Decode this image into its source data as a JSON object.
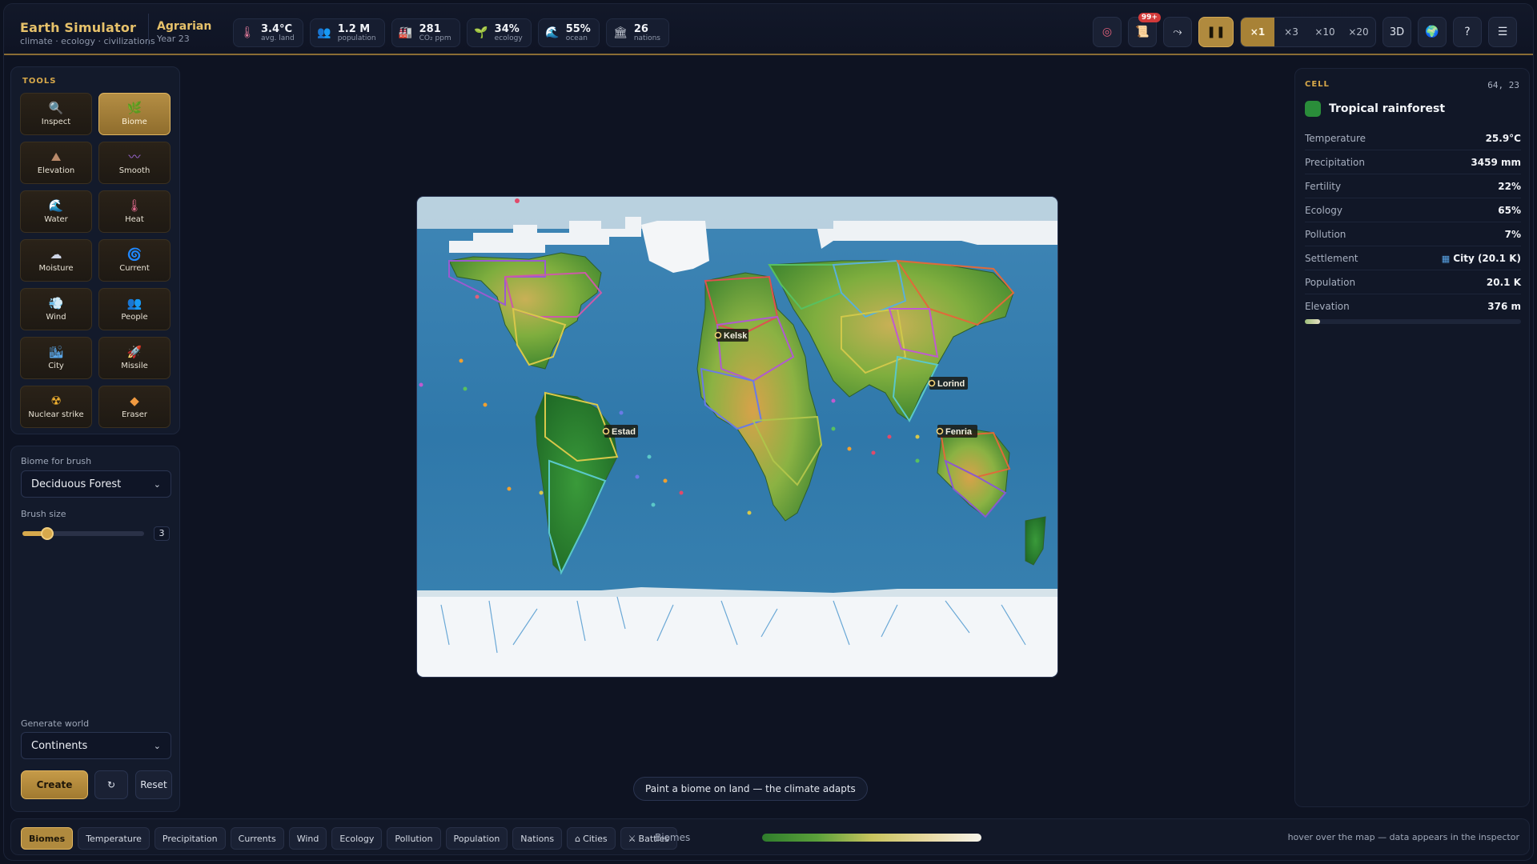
{
  "app": {
    "title": "Earth Simulator",
    "subtitle": "climate · ecology · civilizations",
    "era": "Agrarian",
    "year": "Year 23"
  },
  "stats": [
    {
      "icon": "thermometer-icon",
      "value": "3.4°C",
      "label": "avg. land"
    },
    {
      "icon": "people-icon",
      "value": "1.2 M",
      "label": "population"
    },
    {
      "icon": "factory-icon",
      "value": "281",
      "label": "CO₂ ppm"
    },
    {
      "icon": "sprout-icon",
      "value": "34%",
      "label": "ecology"
    },
    {
      "icon": "wave-icon",
      "value": "55%",
      "label": "ocean"
    },
    {
      "icon": "institution-icon",
      "value": "26",
      "label": "nations"
    }
  ],
  "controls": {
    "notifications_badge": "99+",
    "speeds": [
      "×1",
      "×3",
      "×10",
      "×20"
    ],
    "active_speed": "×1",
    "view_3d": "3D",
    "help": "?"
  },
  "tools": {
    "heading": "TOOLS",
    "items": [
      {
        "label": "Inspect",
        "icon": "magnifier-icon",
        "active": false
      },
      {
        "label": "Biome",
        "icon": "leaf-icon",
        "active": true
      },
      {
        "label": "Elevation",
        "icon": "mountain-icon",
        "active": false
      },
      {
        "label": "Smooth",
        "icon": "wave-icon",
        "active": false
      },
      {
        "label": "Water",
        "icon": "water-icon",
        "active": false
      },
      {
        "label": "Heat",
        "icon": "thermometer-icon",
        "active": false
      },
      {
        "label": "Moisture",
        "icon": "cloud-icon",
        "active": false
      },
      {
        "label": "Current",
        "icon": "spiral-icon",
        "active": false
      },
      {
        "label": "Wind",
        "icon": "wind-icon",
        "active": false
      },
      {
        "label": "People",
        "icon": "people-icon",
        "active": false
      },
      {
        "label": "City",
        "icon": "city-icon",
        "active": false
      },
      {
        "label": "Missile",
        "icon": "rocket-icon",
        "active": false
      },
      {
        "label": "Nuclear strike",
        "icon": "radiation-icon",
        "active": false
      },
      {
        "label": "Eraser",
        "icon": "eraser-icon",
        "active": false
      }
    ]
  },
  "brush": {
    "biome_label": "Biome for brush",
    "biome_value": "Deciduous Forest",
    "size_label": "Brush size",
    "size_value": "3",
    "size_fraction": 0.15,
    "generate_label": "Generate world",
    "generate_value": "Continents",
    "create": "Create",
    "regen": "↻",
    "reset": "Reset"
  },
  "map": {
    "cities": [
      "Kelsk",
      "Lorind",
      "Estad",
      "Fenria"
    ],
    "hint": "Paint a biome on land — the climate adapts"
  },
  "inspector": {
    "heading": "CELL",
    "coord": "64, 23",
    "biome": "Tropical rainforest",
    "biome_color": "#2a8d3a",
    "rows": [
      {
        "k": "Temperature",
        "v": "25.9°C"
      },
      {
        "k": "Precipitation",
        "v": "3459 mm"
      },
      {
        "k": "Fertility",
        "v": "22%"
      },
      {
        "k": "Ecology",
        "v": "65%"
      },
      {
        "k": "Pollution",
        "v": "7%"
      },
      {
        "k": "Settlement",
        "v": "City (20.1 K)"
      },
      {
        "k": "Population",
        "v": "20.1 K"
      },
      {
        "k": "Elevation",
        "v": "376 m"
      }
    ],
    "elevation_fraction": 0.07
  },
  "layers": {
    "items": [
      "Biomes",
      "Temperature",
      "Precipitation",
      "Currents",
      "Wind",
      "Ecology",
      "Pollution",
      "Population",
      "Nations",
      "Cities",
      "Battles"
    ],
    "active": "Biomes",
    "current_name": "Biomes",
    "hint": "hover over the map — data appears in the inspector"
  }
}
